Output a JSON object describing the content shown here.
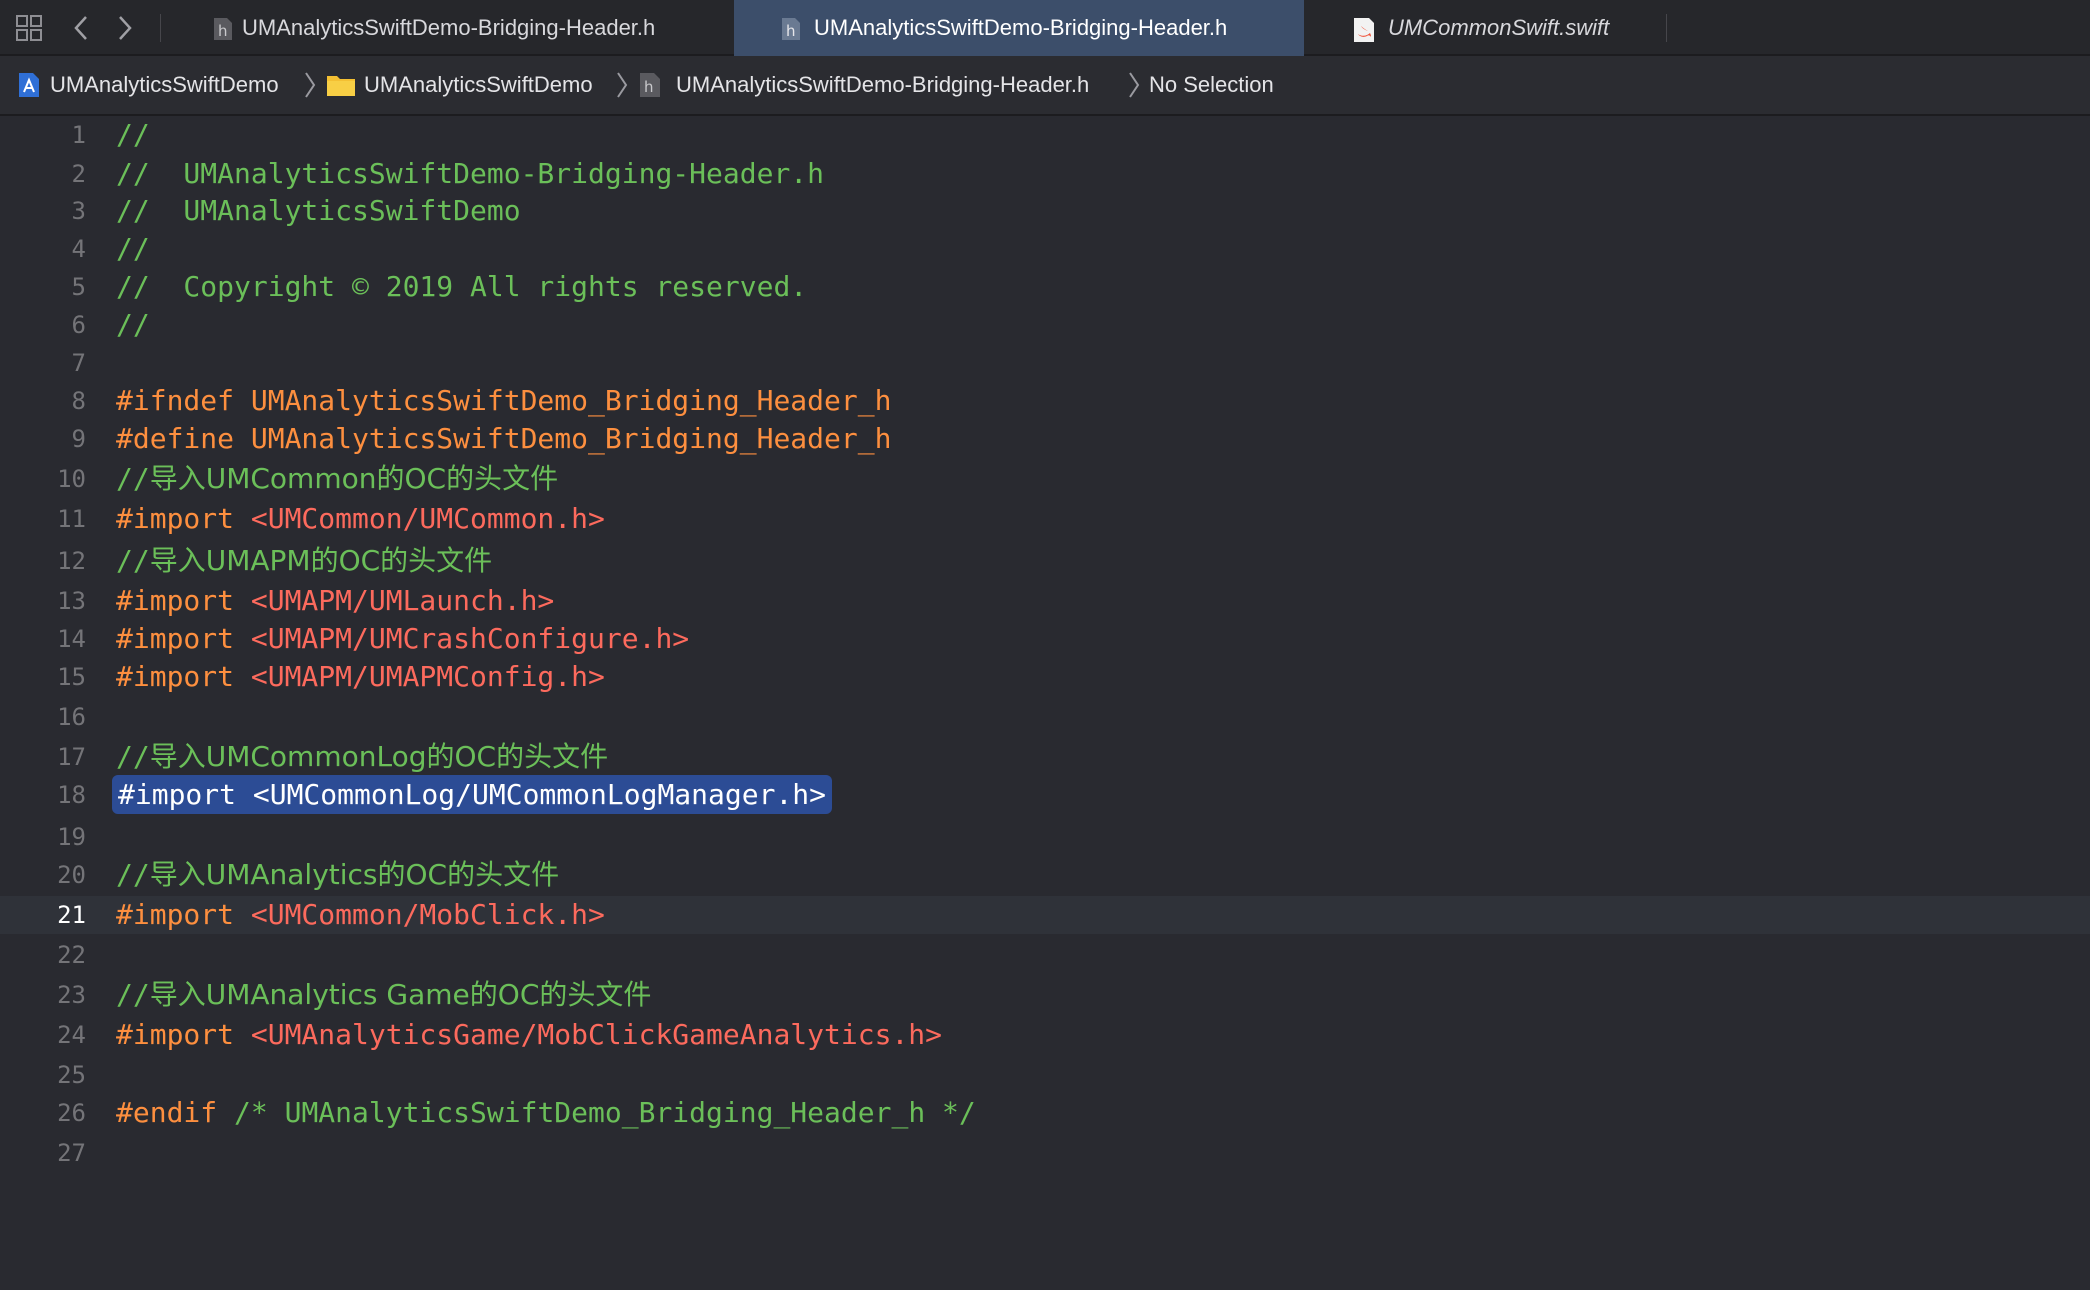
{
  "tabs": [
    {
      "label": "UMAnalyticsSwiftDemo-Bridging-Header.h",
      "icon": "header-file-icon",
      "active": false
    },
    {
      "label": "UMAnalyticsSwiftDemo-Bridging-Header.h",
      "icon": "header-file-icon",
      "active": true
    },
    {
      "label": "UMCommonSwift.swift",
      "icon": "swift-file-icon",
      "active": false
    }
  ],
  "breadcrumb": {
    "project": "UMAnalyticsSwiftDemo",
    "group": "UMAnalyticsSwiftDemo",
    "file": "UMAnalyticsSwiftDemo-Bridging-Header.h",
    "selection": "No Selection"
  },
  "editor": {
    "current_line": 21,
    "selected_line": 18,
    "lines": [
      {
        "n": "1",
        "parts": [
          {
            "t": "//",
            "k": "comment"
          }
        ]
      },
      {
        "n": "2",
        "parts": [
          {
            "t": "//  UMAnalyticsSwiftDemo-Bridging-Header.h",
            "k": "comment"
          }
        ]
      },
      {
        "n": "3",
        "parts": [
          {
            "t": "//  UMAnalyticsSwiftDemo",
            "k": "comment"
          }
        ]
      },
      {
        "n": "4",
        "parts": [
          {
            "t": "//",
            "k": "comment"
          }
        ]
      },
      {
        "n": "5",
        "parts": [
          {
            "t": "//  Copyright © 2019 All rights reserved.",
            "k": "comment"
          }
        ]
      },
      {
        "n": "6",
        "parts": [
          {
            "t": "//",
            "k": "comment"
          }
        ]
      },
      {
        "n": "7",
        "parts": []
      },
      {
        "n": "8",
        "parts": [
          {
            "t": "#ifndef UMAnalyticsSwiftDemo_Bridging_Header_h",
            "k": "pre"
          }
        ]
      },
      {
        "n": "9",
        "parts": [
          {
            "t": "#define UMAnalyticsSwiftDemo_Bridging_Header_h",
            "k": "pre"
          }
        ]
      },
      {
        "n": "10",
        "parts": [
          {
            "t": "//",
            "k": "comment"
          },
          {
            "t": "导入UMCommon的OC的头文件",
            "k": "comment-cn"
          }
        ]
      },
      {
        "n": "11",
        "parts": [
          {
            "t": "#import ",
            "k": "pre"
          },
          {
            "t": "<UMCommon/UMCommon.h>",
            "k": "str"
          }
        ]
      },
      {
        "n": "12",
        "parts": [
          {
            "t": "//",
            "k": "comment"
          },
          {
            "t": "导入UMAPM的OC的头文件",
            "k": "comment-cn"
          }
        ]
      },
      {
        "n": "13",
        "parts": [
          {
            "t": "#import ",
            "k": "pre"
          },
          {
            "t": "<UMAPM/UMLaunch.h>",
            "k": "str"
          }
        ]
      },
      {
        "n": "14",
        "parts": [
          {
            "t": "#import ",
            "k": "pre"
          },
          {
            "t": "<UMAPM/UMCrashConfigure.h>",
            "k": "str"
          }
        ]
      },
      {
        "n": "15",
        "parts": [
          {
            "t": "#import ",
            "k": "pre"
          },
          {
            "t": "<UMAPM/UMAPMConfig.h>",
            "k": "str"
          }
        ]
      },
      {
        "n": "16",
        "parts": []
      },
      {
        "n": "17",
        "parts": [
          {
            "t": "//",
            "k": "comment"
          },
          {
            "t": "导入UMCommonLog的OC的头文件",
            "k": "comment-cn"
          }
        ]
      },
      {
        "n": "18",
        "parts": [
          {
            "t": "#import <UMCommonLog/UMCommonLogManager.h>",
            "k": "selected"
          }
        ]
      },
      {
        "n": "19",
        "parts": []
      },
      {
        "n": "20",
        "parts": [
          {
            "t": "//",
            "k": "comment"
          },
          {
            "t": "导入UMAnalytics的OC的头文件",
            "k": "comment-cn"
          }
        ]
      },
      {
        "n": "21",
        "parts": [
          {
            "t": "#import ",
            "k": "pre"
          },
          {
            "t": "<UMCommon/MobClick.h>",
            "k": "str"
          }
        ]
      },
      {
        "n": "22",
        "parts": []
      },
      {
        "n": "23",
        "parts": [
          {
            "t": "//",
            "k": "comment"
          },
          {
            "t": "导入UMAnalytics Game的OC的头文件",
            "k": "comment-cn"
          }
        ]
      },
      {
        "n": "24",
        "parts": [
          {
            "t": "#import ",
            "k": "pre"
          },
          {
            "t": "<UMAnalyticsGame/MobClickGameAnalytics.h>",
            "k": "str"
          }
        ]
      },
      {
        "n": "25",
        "parts": []
      },
      {
        "n": "26",
        "parts": [
          {
            "t": "#endif ",
            "k": "pre"
          },
          {
            "t": "/* UMAnalyticsSwiftDemo_Bridging_Header_h */",
            "k": "comment"
          }
        ]
      },
      {
        "n": "27",
        "parts": []
      }
    ]
  },
  "colors": {
    "background": "#292a30",
    "comment": "#6bbf59",
    "preprocessor": "#fd8f3f",
    "string": "#fc6a5d",
    "selection": "#2c4c95",
    "active_tab": "#3c4e6a"
  }
}
